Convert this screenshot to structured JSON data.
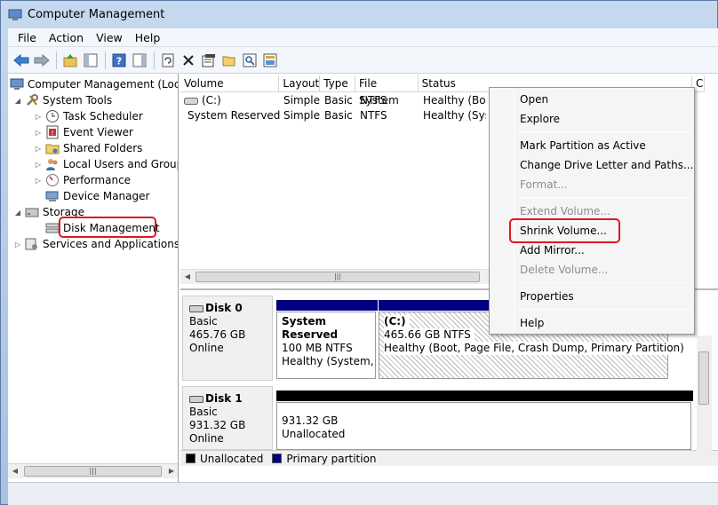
{
  "window": {
    "title": "Computer Management"
  },
  "menu": [
    "File",
    "Action",
    "View",
    "Help"
  ],
  "toolbar": {
    "icons": [
      "back-icon",
      "forward-icon",
      "up-icon",
      "show-hide-tree-icon",
      "help-icon",
      "show-hide-action-icon",
      "refresh-icon",
      "delete-icon",
      "properties-icon",
      "open-icon",
      "search-icon",
      "help-topics-icon"
    ]
  },
  "tree": {
    "root": "Computer Management (Local",
    "system_tools": "System Tools",
    "task_scheduler": "Task Scheduler",
    "event_viewer": "Event Viewer",
    "shared_folders": "Shared Folders",
    "local_users": "Local Users and Groups",
    "performance": "Performance",
    "device_manager": "Device Manager",
    "storage": "Storage",
    "disk_management": "Disk Management",
    "services": "Services and Applications"
  },
  "volume_list": {
    "columns": [
      "Volume",
      "Layout",
      "Type",
      "File System",
      "Status",
      "C"
    ],
    "rows": [
      {
        "volume": "(C:)",
        "layout": "Simple",
        "type": "Basic",
        "fs": "NTFS",
        "status": "Healthy (Boo"
      },
      {
        "volume": "System Reserved",
        "layout": "Simple",
        "type": "Basic",
        "fs": "NTFS",
        "status": "Healthy (Syst"
      }
    ]
  },
  "disks": [
    {
      "name": "Disk 0",
      "type": "Basic",
      "size": "465.76 GB",
      "state": "Online"
    },
    {
      "name": "Disk 1",
      "type": "Basic",
      "size": "931.32 GB",
      "state": "Online"
    }
  ],
  "partitions": {
    "sysres": {
      "name": "System Reserved",
      "size": "100 MB NTFS",
      "status": "Healthy (System, A"
    },
    "c": {
      "name": "(C:)",
      "size": "465.66 GB NTFS",
      "status": "Healthy (Boot, Page File, Crash Dump, Primary Partition)"
    },
    "unalloc": {
      "size": "931.32 GB",
      "status": "Unallocated"
    }
  },
  "legend": {
    "unallocated": "Unallocated",
    "primary": "Primary partition"
  },
  "context_menu": {
    "open": "Open",
    "explore": "Explore",
    "mark_active": "Mark Partition as Active",
    "change_letter": "Change Drive Letter and Paths...",
    "format": "Format...",
    "extend": "Extend Volume...",
    "shrink": "Shrink Volume...",
    "add_mirror": "Add Mirror...",
    "delete": "Delete Volume...",
    "properties": "Properties",
    "help": "Help"
  },
  "colors": {
    "highlight": "#e0191f",
    "primary_partition": "#000080",
    "unallocated": "#000000"
  }
}
